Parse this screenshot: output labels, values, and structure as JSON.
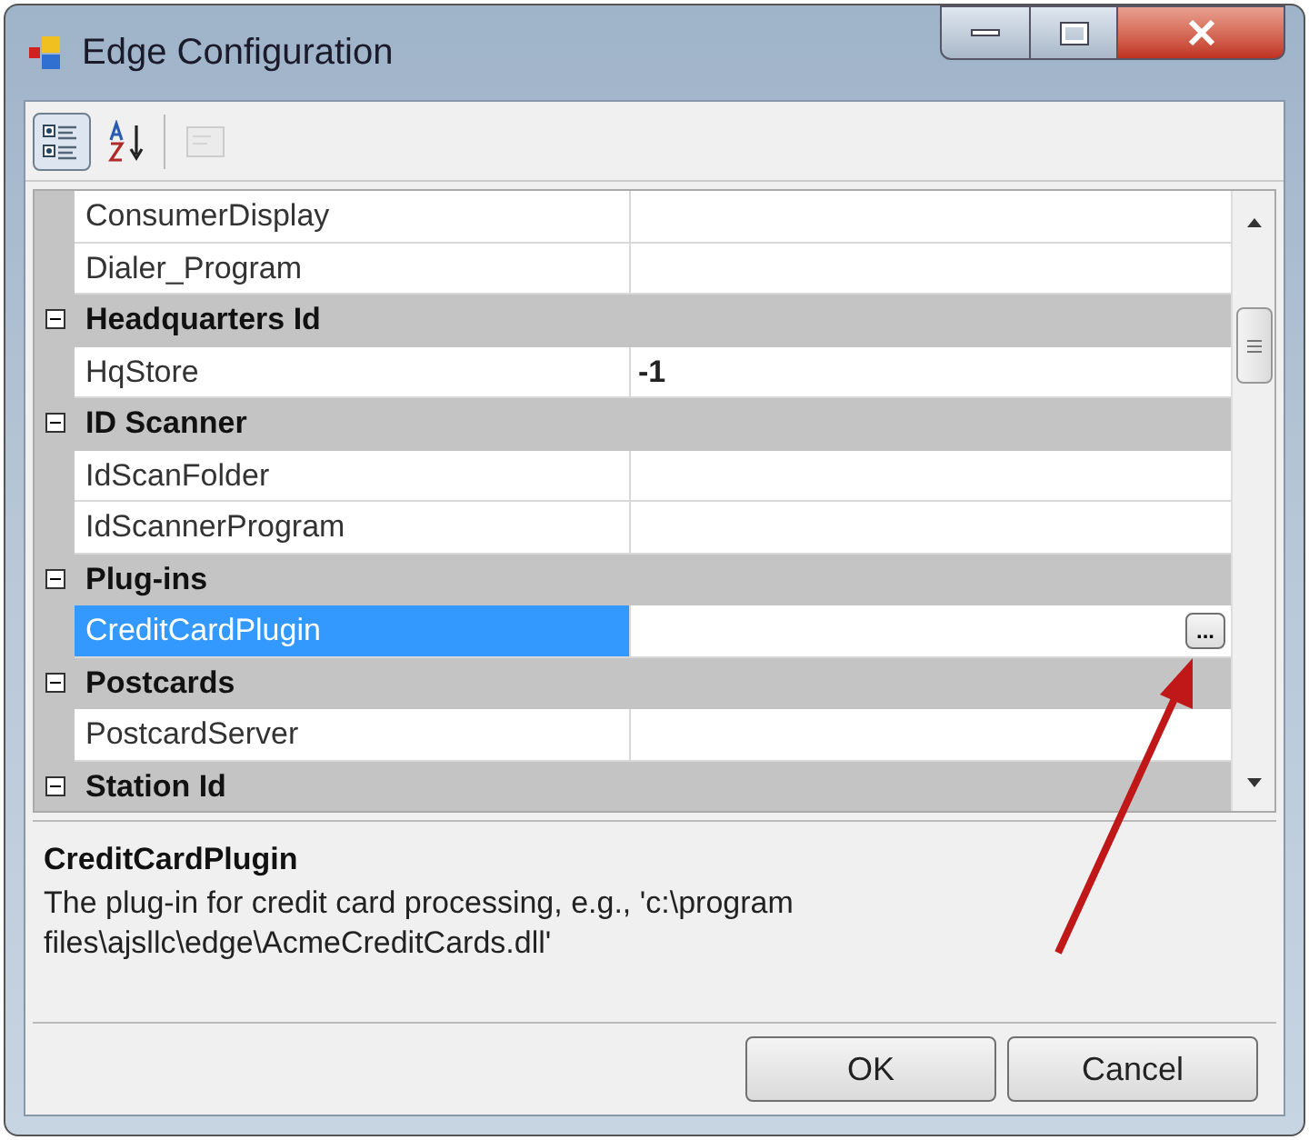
{
  "window": {
    "title": "Edge Configuration"
  },
  "toolbar": [
    {
      "kind": "categorized",
      "selected": true,
      "disabled": false
    },
    {
      "kind": "alphabetical",
      "selected": false,
      "disabled": false
    },
    {
      "kind": "pages",
      "selected": false,
      "disabled": true
    }
  ],
  "grid": {
    "rows": [
      {
        "kind": "property",
        "name": "ConsumerDisplay",
        "selected": false
      },
      {
        "kind": "property",
        "name": "Dialer_Program",
        "selected": false
      },
      {
        "kind": "category",
        "name": "Headquarters Id",
        "expanded": true
      },
      {
        "kind": "property",
        "name": "HqStore",
        "value": "-1",
        "selected": false
      },
      {
        "kind": "category",
        "name": "ID Scanner",
        "expanded": true
      },
      {
        "kind": "property",
        "name": "IdScanFolder",
        "selected": false
      },
      {
        "kind": "property",
        "name": "IdScannerProgram",
        "selected": false
      },
      {
        "kind": "category",
        "name": "Plug-ins",
        "expanded": true
      },
      {
        "kind": "property",
        "name": "CreditCardPlugin",
        "selected": true,
        "button": "..."
      },
      {
        "kind": "category",
        "name": "Postcards",
        "expanded": true
      },
      {
        "kind": "property",
        "name": "PostcardServer",
        "selected": false
      },
      {
        "kind": "category",
        "name": "Station Id",
        "expanded": true
      }
    ]
  },
  "description": {
    "title": "CreditCardPlugin",
    "text": "The plug-in for credit card processing, e.g., 'c:\\program files\\ajsllc\\edge\\AcmeCreditCards.dll'"
  },
  "buttons": [
    "OK",
    "Cancel"
  ]
}
